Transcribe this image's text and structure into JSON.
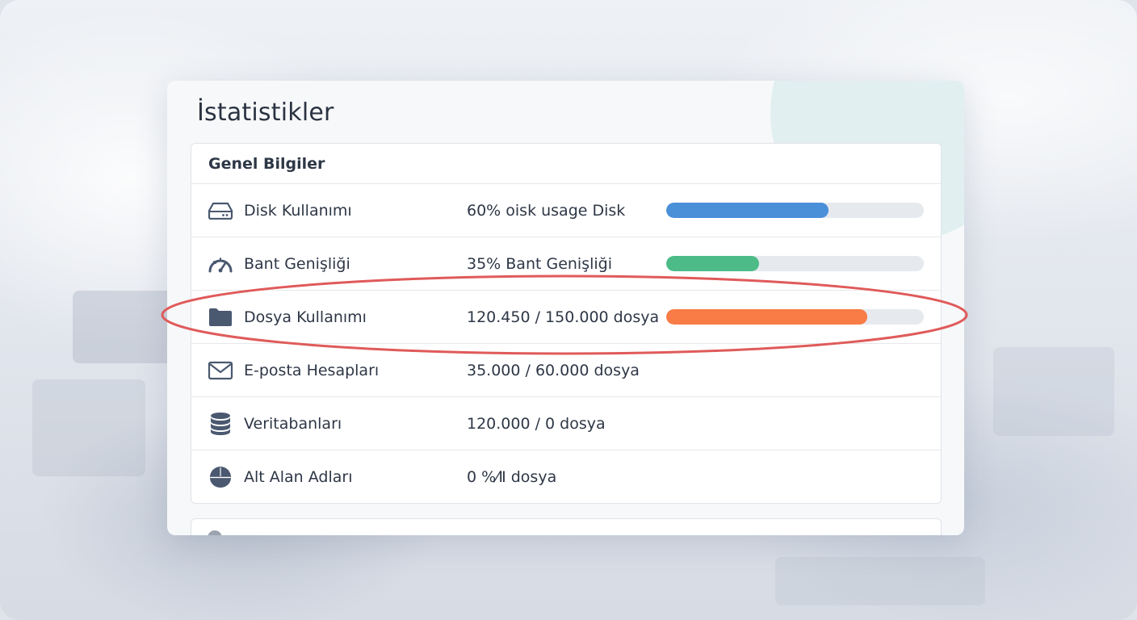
{
  "page": {
    "title": "İstatistikler"
  },
  "general_info": {
    "header": "Genel Bilgiler",
    "rows": [
      {
        "icon": "hard-drive-icon",
        "label": "Disk Kullanımı",
        "value": "60% oisk usage Disk",
        "progress": 0.63,
        "bar_color": "#4a90d9"
      },
      {
        "icon": "speedometer-icon",
        "label": "Bant Genişliği",
        "value": "35% Bant Genişliği",
        "progress": 0.36,
        "bar_color": "#4cbb87"
      },
      {
        "icon": "folder-icon",
        "label": "Dosya Kullanımı",
        "value": "120.450 / 150.000 dosya",
        "progress": 0.78,
        "bar_color": "#f97b45"
      },
      {
        "icon": "envelope-icon",
        "label": "E-posta Hesapları",
        "value": "35.000 / 60.000 dosya"
      },
      {
        "icon": "database-icon",
        "label": "Veritabanları",
        "value": "120.000 / 0 dosya"
      },
      {
        "icon": "globe-icon",
        "label": "Alt Alan Adları",
        "value": "0 %⁄Ⅱ dosya"
      }
    ]
  },
  "highlight": {
    "target": "Dosya Kullanımı",
    "color": "#e05a5a"
  }
}
